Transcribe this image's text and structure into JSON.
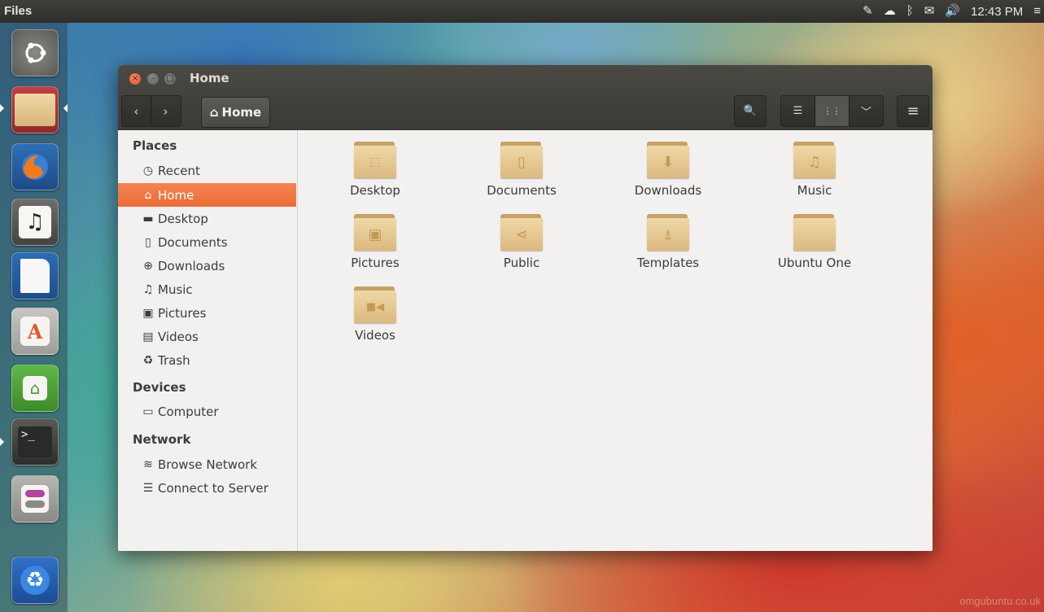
{
  "panel": {
    "app_title": "Files",
    "clock": "12:43 PM",
    "indicators": [
      "pen-icon",
      "cloud-icon",
      "bluetooth-icon",
      "mail-icon",
      "volume-icon",
      "session-menu-icon"
    ]
  },
  "launcher": {
    "items": [
      "ubuntu-dash-icon",
      "files-icon",
      "firefox-icon",
      "rhythmbox-icon",
      "libreoffice-icon",
      "software-center-icon",
      "update-manager-icon",
      "terminal-icon",
      "system-settings-icon",
      "trash-icon"
    ]
  },
  "window": {
    "title": "Home",
    "toolbar": {
      "back_label": "‹",
      "forward_label": "›",
      "path_label": "Home",
      "search_label": "🔍",
      "list_view_label": "☰",
      "grid_view_label": "⋮⋮",
      "view_options_label": "﹀",
      "menu_label": "≡"
    },
    "sidebar": {
      "places_heading": "Places",
      "places": [
        {
          "label": "Recent",
          "icon": "clock-icon"
        },
        {
          "label": "Home",
          "icon": "home-icon"
        },
        {
          "label": "Desktop",
          "icon": "desktop-icon"
        },
        {
          "label": "Documents",
          "icon": "document-icon"
        },
        {
          "label": "Downloads",
          "icon": "download-icon"
        },
        {
          "label": "Music",
          "icon": "music-icon"
        },
        {
          "label": "Pictures",
          "icon": "pictures-icon"
        },
        {
          "label": "Videos",
          "icon": "video-icon"
        },
        {
          "label": "Trash",
          "icon": "trash-icon"
        }
      ],
      "devices_heading": "Devices",
      "devices": [
        {
          "label": "Computer",
          "icon": "computer-icon"
        }
      ],
      "network_heading": "Network",
      "network": [
        {
          "label": "Browse Network",
          "icon": "wifi-icon"
        },
        {
          "label": "Connect to Server",
          "icon": "server-icon"
        }
      ]
    },
    "files": [
      {
        "label": "Desktop",
        "emblem": "⬚"
      },
      {
        "label": "Documents",
        "emblem": "▯"
      },
      {
        "label": "Downloads",
        "emblem": "⬇"
      },
      {
        "label": "Music",
        "emblem": "♫"
      },
      {
        "label": "Pictures",
        "emblem": "▣"
      },
      {
        "label": "Public",
        "emblem": "⋖"
      },
      {
        "label": "Templates",
        "emblem": "⍋"
      },
      {
        "label": "Ubuntu One",
        "emblem": ""
      },
      {
        "label": "Videos",
        "emblem": "■◀"
      }
    ]
  },
  "watermark": "omgubuntu.co.uk"
}
